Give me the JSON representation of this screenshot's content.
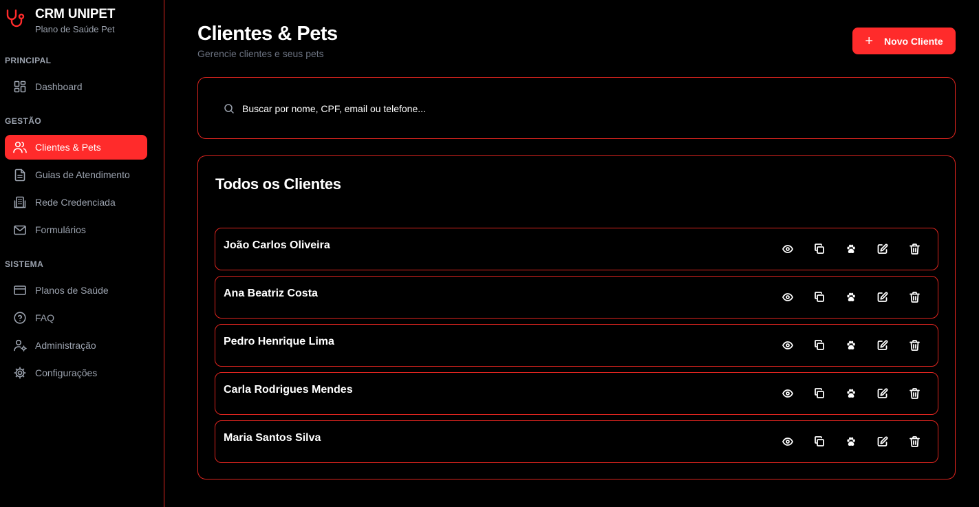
{
  "brand": {
    "title": "CRM UNIPET",
    "subtitle": "Plano de Saúde Pet"
  },
  "sidebar": {
    "sections": [
      {
        "label": "PRINCIPAL"
      },
      {
        "label": "GESTÃO"
      },
      {
        "label": "SISTEMA"
      }
    ],
    "items": [
      {
        "label": "Dashboard",
        "icon": "dashboard-icon"
      },
      {
        "label": "Clientes & Pets",
        "icon": "users-icon",
        "active": true
      },
      {
        "label": "Guias de Atendimento",
        "icon": "document-icon"
      },
      {
        "label": "Rede Credenciada",
        "icon": "building-icon"
      },
      {
        "label": "Formulários",
        "icon": "mail-icon"
      },
      {
        "label": "Planos de Saúde",
        "icon": "credit-card-icon"
      },
      {
        "label": "FAQ",
        "icon": "help-circle-icon"
      },
      {
        "label": "Administração",
        "icon": "user-cog-icon"
      },
      {
        "label": "Configurações",
        "icon": "gear-icon"
      }
    ]
  },
  "header": {
    "title": "Clientes & Pets",
    "subtitle": "Gerencie clientes e seus pets",
    "new_button": "Novo Cliente"
  },
  "search": {
    "placeholder": "Buscar por nome, CPF, email ou telefone...",
    "value": ""
  },
  "clients": {
    "title": "Todos os Clientes",
    "rows": [
      {
        "name": "João Carlos Oliveira"
      },
      {
        "name": "Ana Beatriz Costa"
      },
      {
        "name": "Pedro Henrique Lima"
      },
      {
        "name": "Carla Rodrigues Mendes"
      },
      {
        "name": "Maria Santos Silva"
      }
    ],
    "actions": [
      "view-icon",
      "copy-icon",
      "paw-icon",
      "edit-icon",
      "trash-icon"
    ]
  },
  "colors": {
    "accent": "#ff2b2b",
    "border": "#e0251f",
    "muted": "#9ca3af",
    "background": "#000000"
  }
}
